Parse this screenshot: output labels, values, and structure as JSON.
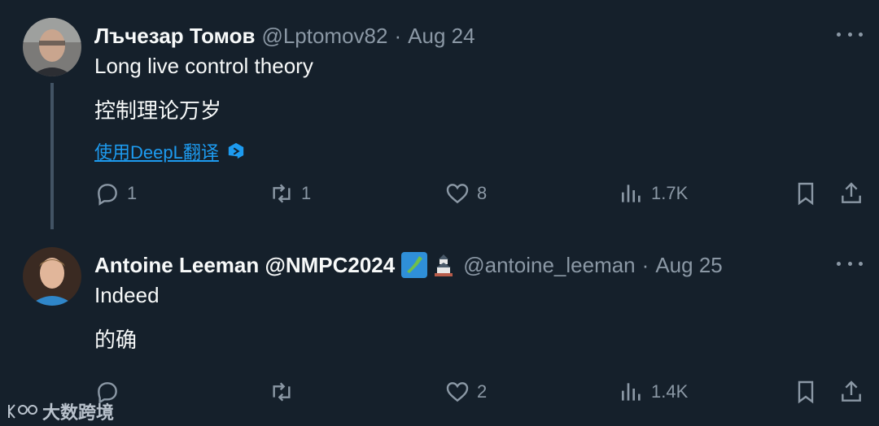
{
  "tweet1": {
    "name": "Лъчезар Томов",
    "handle": "@Lptomov82",
    "date": "Aug 24",
    "text": "Long live control theory",
    "translation": "控制理论万岁",
    "translate_link": "使用DeepL翻译",
    "replies": "1",
    "reposts": "1",
    "likes": "8",
    "views": "1.7K"
  },
  "tweet2": {
    "name": "Antoine Leeman @NMPC2024",
    "handle": "@antoine_leeman",
    "date": "Aug 25",
    "text": "Indeed",
    "translation": "的确",
    "replies": "",
    "reposts": "",
    "likes": "2",
    "views": "1.4K"
  },
  "separator": "·",
  "watermark": "大数跨境",
  "colors": {
    "background": "#15202b",
    "accent": "#1d9bf0",
    "muted": "#8b98a5",
    "text": "#f7f9f9"
  }
}
